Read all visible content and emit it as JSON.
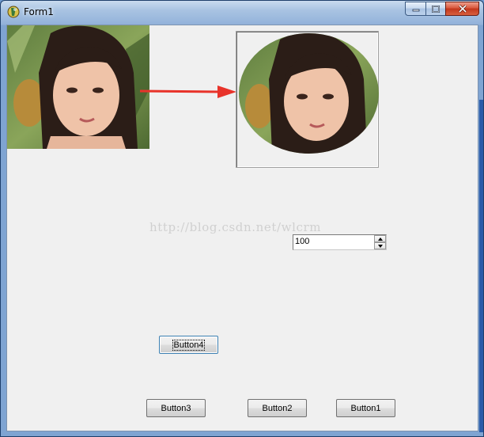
{
  "window": {
    "title": "Form1",
    "app_icon": "delphi-app-icon",
    "controls": {
      "minimize": "minimize-icon",
      "maximize": "maximize-icon",
      "close": "close-icon"
    }
  },
  "images": {
    "left": "portrait-photo-square",
    "right": "portrait-photo-circular-crop",
    "arrow_color": "#e8332a"
  },
  "watermark": "http://blog.csdn.net/wlcrm",
  "spin_edit": {
    "value": "100"
  },
  "buttons": {
    "button4": "Button4",
    "button3": "Button3",
    "button2": "Button2",
    "button1": "Button1"
  }
}
